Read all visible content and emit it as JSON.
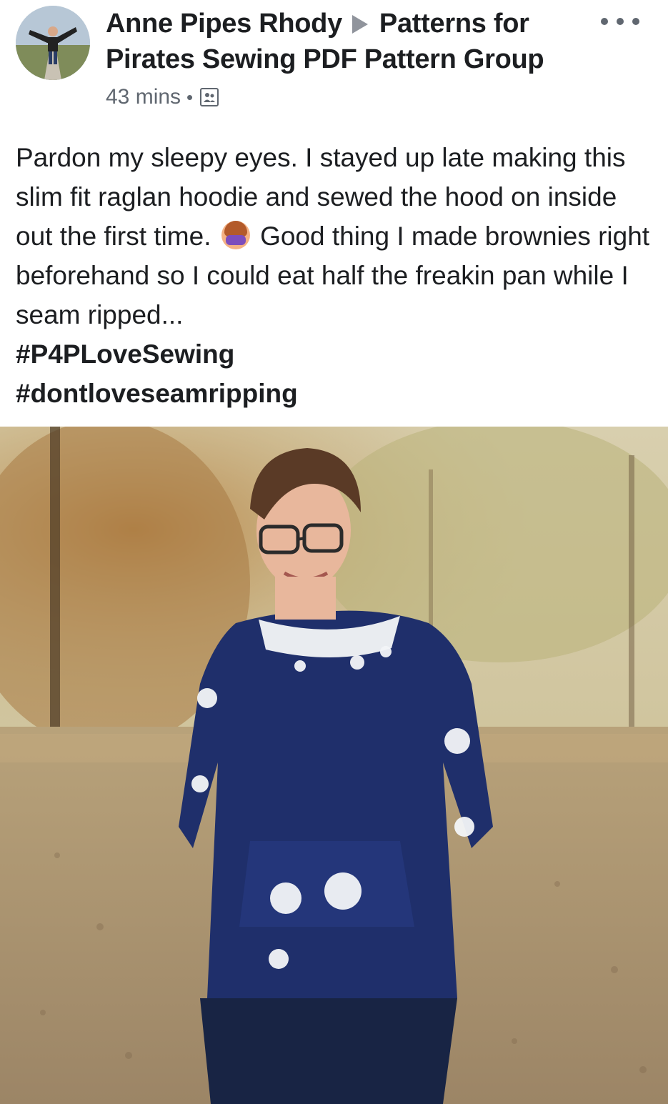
{
  "post": {
    "author": "Anne Pipes Rhody",
    "group": "Patterns for Pirates Sewing PDF Pattern Group",
    "timestamp": "43 mins",
    "separator": "•",
    "audience_icon": "group-members-icon",
    "more_icon": "ellipsis-icon",
    "text_lines": [
      "Pardon my sleepy eyes. I stayed up late making this slim fit raglan hoodie and sewed the hood on inside out the first time.",
      "Good thing I made brownies right beforehand so I could eat half the freakin pan while I seam ripped..."
    ],
    "emoji": "woman-facepalming-emoji",
    "hashtags": [
      "#P4PLoveSewing",
      "#dontloveseamripping"
    ],
    "colors": {
      "text": "#1c1e21",
      "secondary_text": "#606770",
      "arrow": "#90949c",
      "hoodie_navy": "#1f2f6b"
    }
  }
}
